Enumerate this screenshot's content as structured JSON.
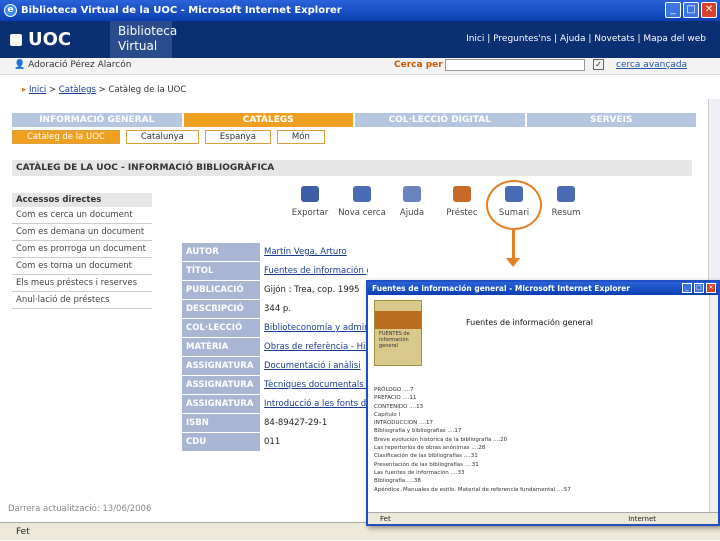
{
  "window": {
    "title": "Biblioteca Virtual de la UOC - Microsoft Internet Explorer",
    "minimize": "_",
    "maximize": "□",
    "close": "✕"
  },
  "brand": {
    "logo": "UOC",
    "subtitle_1": "Biblioteca",
    "subtitle_2": "Virtual",
    "accent": "#0b2f73"
  },
  "topnav": {
    "text": "Inici | Preguntes'ns | Ajuda | Novetats | Mapa del web"
  },
  "userbar": {
    "user": "Adoració Pérez Alarcón",
    "search_label": "Cerca per",
    "search_value": "",
    "search_button": "✓",
    "advanced": "cerca avançada"
  },
  "breadcrumb": {
    "home": "Inici",
    "sep1": " > ",
    "catalogs": "Catàlegs",
    "sep2": " > ",
    "current": "Catàleg de la UOC"
  },
  "tabs": [
    {
      "label": "INFORMACIÓ GENERAL",
      "active": false
    },
    {
      "label": "CATÀLEGS",
      "active": true
    },
    {
      "label": "COL·LECCIÓ DIGITAL",
      "active": false
    },
    {
      "label": "SERVEIS",
      "active": false
    }
  ],
  "subtabs": [
    {
      "label": "Catàleg de la UOC",
      "active": true
    },
    {
      "label": "Catalunya",
      "active": false
    },
    {
      "label": "Espanya",
      "active": false
    },
    {
      "label": "Món",
      "active": false
    }
  ],
  "section_title": "CATÀLEG DE LA UOC - INFORMACIÓ BIBLIOGRÀFICA",
  "leftnav": {
    "heading": "Accessos directes",
    "items": [
      "Com es cerca un document",
      "Com es demana un document",
      "Com es prorroga un document",
      "Com es torna un document",
      "Els meus préstecs i reserves",
      "Anul·lació de préstecs"
    ]
  },
  "actions": [
    {
      "label": "Exportar",
      "icon": "export-icon"
    },
    {
      "label": "Nova cerca",
      "icon": "search-icon"
    },
    {
      "label": "Ajuda",
      "icon": "help-icon"
    },
    {
      "label": "Préstec",
      "icon": "loan-icon"
    },
    {
      "label": "Sumari",
      "icon": "summary-icon"
    },
    {
      "label": "Resum",
      "icon": "abstract-icon"
    }
  ],
  "record": [
    {
      "label": "AUTOR",
      "value": "Martín Vega, Arturo",
      "link": true
    },
    {
      "label": "TÍTOL",
      "value": "Fuentes de información general / Arturo Martín Vega",
      "link": true
    },
    {
      "label": "PUBLICACIÓ",
      "value": "Gijón : Trea, cop. 1995",
      "link": false
    },
    {
      "label": "DESCRIPCIÓ",
      "value": "344 p.",
      "link": false
    },
    {
      "label": "COL·LECCIÓ",
      "value": "Biblioteconomía y administración cultural",
      "link": true
    },
    {
      "label": "MATÈRIA",
      "value": "Obras de referència - Història",
      "link": true
    },
    {
      "label": "ASSIGNATURA",
      "value": "Documentació i anàlisi",
      "link": true
    },
    {
      "label": "ASSIGNATURA",
      "value": "Tècniques documentals i fonts",
      "link": true
    },
    {
      "label": "ASSIGNATURA",
      "value": "Introducció a les fonts d'informació",
      "link": true
    },
    {
      "label": "ISBN",
      "value": "84-89427-29-1",
      "link": false
    },
    {
      "label": "CDU",
      "value": "011",
      "link": false
    }
  ],
  "last_update": "Darrera actualització: 13/06/2006",
  "statusbar": {
    "text": "Fet"
  },
  "popup": {
    "title": "Fuentes de información general - Microsoft Internet Explorer",
    "heading": "Fuentes de información general",
    "book_title": "FUENTES de información general",
    "toc": [
      "PRÓLOGO ....7",
      "PREFACIO ....11",
      "CONTENIDO ....13",
      "Capítulo I",
      "INTRODUCCIÓN ....17",
      "Bibliografía y bibliografías ....17",
      "Breve evolución histórica de la bibliografía ....20",
      "Las repertorios de obras anónimas ....28",
      "Clasificación de las bibliografías ....31",
      "Presentación de las bibliografías ....31",
      "Las fuentes de información ....33",
      "Bibliografía ....38",
      "Apéndice. Manuales de estilo. Material de referencia fundamental ....57"
    ],
    "status": "Fet",
    "zone": "Internet"
  }
}
